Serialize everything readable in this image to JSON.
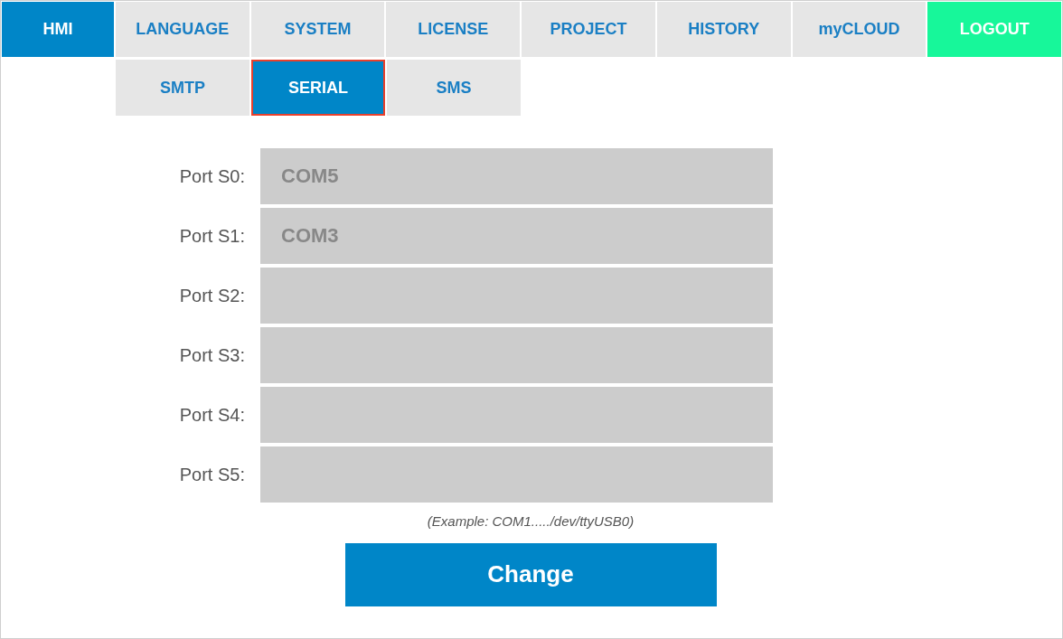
{
  "tabs": [
    {
      "label": "HMI",
      "kind": "tab",
      "selected": true
    },
    {
      "label": "LANGUAGE",
      "kind": "tab",
      "selected": false
    },
    {
      "label": "SYSTEM",
      "kind": "tab",
      "selected": false
    },
    {
      "label": "LICENSE",
      "kind": "tab",
      "selected": false
    },
    {
      "label": "PROJECT",
      "kind": "tab",
      "selected": false
    },
    {
      "label": "HISTORY",
      "kind": "tab",
      "selected": false
    },
    {
      "label": "myCLOUD",
      "kind": "tab",
      "selected": false
    },
    {
      "label": "LOGOUT",
      "kind": "logout"
    }
  ],
  "subtabs": [
    {
      "label": "SMTP",
      "selected": false
    },
    {
      "label": "SERIAL",
      "selected": true
    },
    {
      "label": "SMS",
      "selected": false
    }
  ],
  "ports": [
    {
      "label": "Port S0:",
      "value": "COM5"
    },
    {
      "label": "Port S1:",
      "value": "COM3"
    },
    {
      "label": "Port S2:"
    },
    {
      "label": "Port S3:"
    },
    {
      "label": "Port S4:"
    },
    {
      "label": "Port S5:"
    }
  ],
  "note": "(Example: COM1...../dev/ttyUSB0)",
  "button": "Change"
}
